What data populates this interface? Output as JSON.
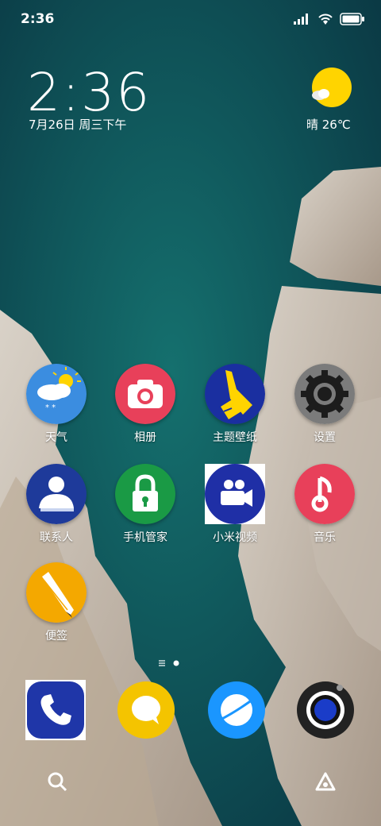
{
  "status_bar": {
    "time": "2:36"
  },
  "clock": {
    "time": "2:36",
    "date": "7月26日 周三下午"
  },
  "weather": {
    "text": "晴 26℃",
    "icon": "sunny-icon"
  },
  "apps": [
    {
      "label": "天气",
      "icon": "weather-icon"
    },
    {
      "label": "相册",
      "icon": "camera-icon"
    },
    {
      "label": "主题壁纸",
      "icon": "paintbrush-icon"
    },
    {
      "label": "设置",
      "icon": "gear-icon"
    },
    {
      "label": "联系人",
      "icon": "contacts-icon"
    },
    {
      "label": "手机管家",
      "icon": "lock-icon"
    },
    {
      "label": "小米视频",
      "icon": "video-camera-icon"
    },
    {
      "label": "音乐",
      "icon": "music-note-icon"
    },
    {
      "label": "便签",
      "icon": "pencil-icon"
    }
  ],
  "dock": [
    {
      "icon": "phone-icon"
    },
    {
      "icon": "chat-bubble-icon"
    },
    {
      "icon": "browser-icon"
    },
    {
      "icon": "camera-lens-icon"
    }
  ],
  "colors": {
    "weather_bg": "#3b8de0",
    "gallery_bg": "#e8405a",
    "themes_bg": "#1a2fa0",
    "settings_bg": "#7b7b7b",
    "contacts_bg": "#1e3a9a",
    "security_bg": "#1a9a45",
    "video_bg": "#1f2fa6",
    "music_bg": "#e8405a",
    "notes_bg": "#f4a800"
  }
}
